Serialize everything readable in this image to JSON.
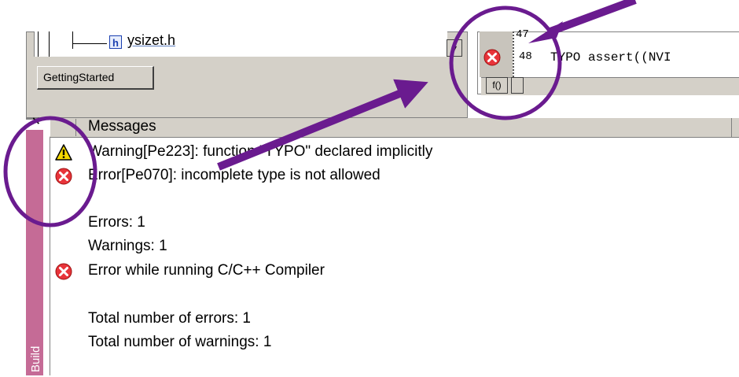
{
  "workspace": {
    "file_name": "ysizet.h",
    "file_icon_letter": "h",
    "scroll_arrow": "▾",
    "tab_label": "GettingStarted"
  },
  "editor": {
    "line_partial": "47",
    "line_number": "48",
    "code_line": "TYPO assert((NVI",
    "tab1_label": "f()"
  },
  "messages_panel": {
    "close_label": "×",
    "header": "Messages",
    "side_label": "Build",
    "lines": {
      "warning": "Warning[Pe223]: function \"TYPO\" declared implicitly",
      "error": "Error[Pe070]: incomplete type is not allowed",
      "errors_count": "Errors: 1",
      "warnings_count": "Warnings: 1",
      "compiler_error": "Error while running C/C++ Compiler",
      "total_errors": "Total number of errors: 1",
      "total_warnings": "Total number of warnings: 1"
    }
  },
  "colors": {
    "annotation_purple": "#6a1b8f",
    "build_strip": "#c56b96",
    "error_red": "#e8343a",
    "warning_yellow": "#f5d800"
  }
}
